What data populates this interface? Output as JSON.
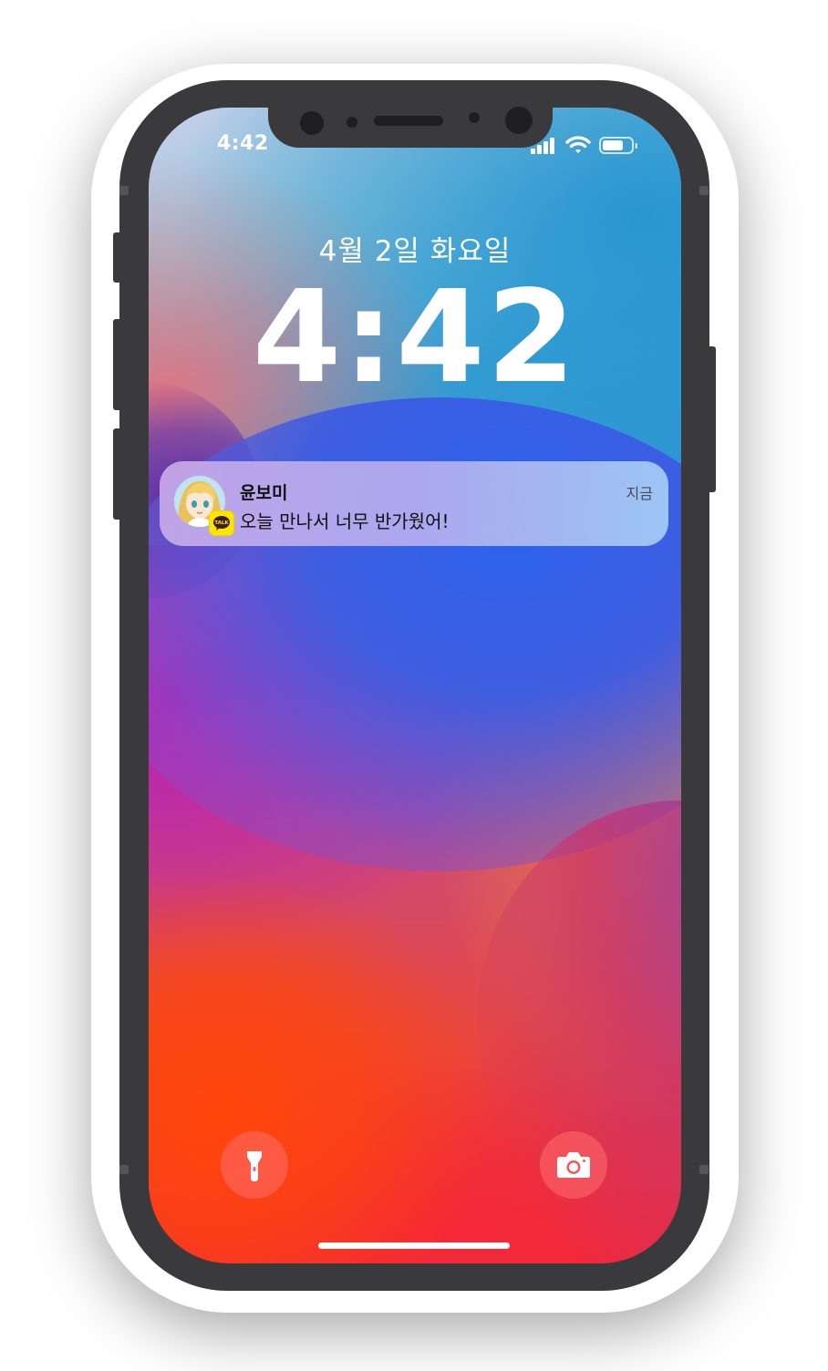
{
  "status_bar": {
    "time": "4:42",
    "icons": [
      "signal-icon",
      "wifi-icon",
      "battery-icon"
    ]
  },
  "lock_screen": {
    "date": "4월 2일 화요일",
    "clock": "4:42"
  },
  "notification": {
    "sender": "윤보미",
    "message": "오늘 만나서 너무 반가웠어!",
    "time": "지금",
    "app_icon": "kakaotalk-icon",
    "badge_text": "TALK"
  },
  "quick_actions": {
    "left": "flashlight-icon",
    "right": "camera-icon"
  }
}
